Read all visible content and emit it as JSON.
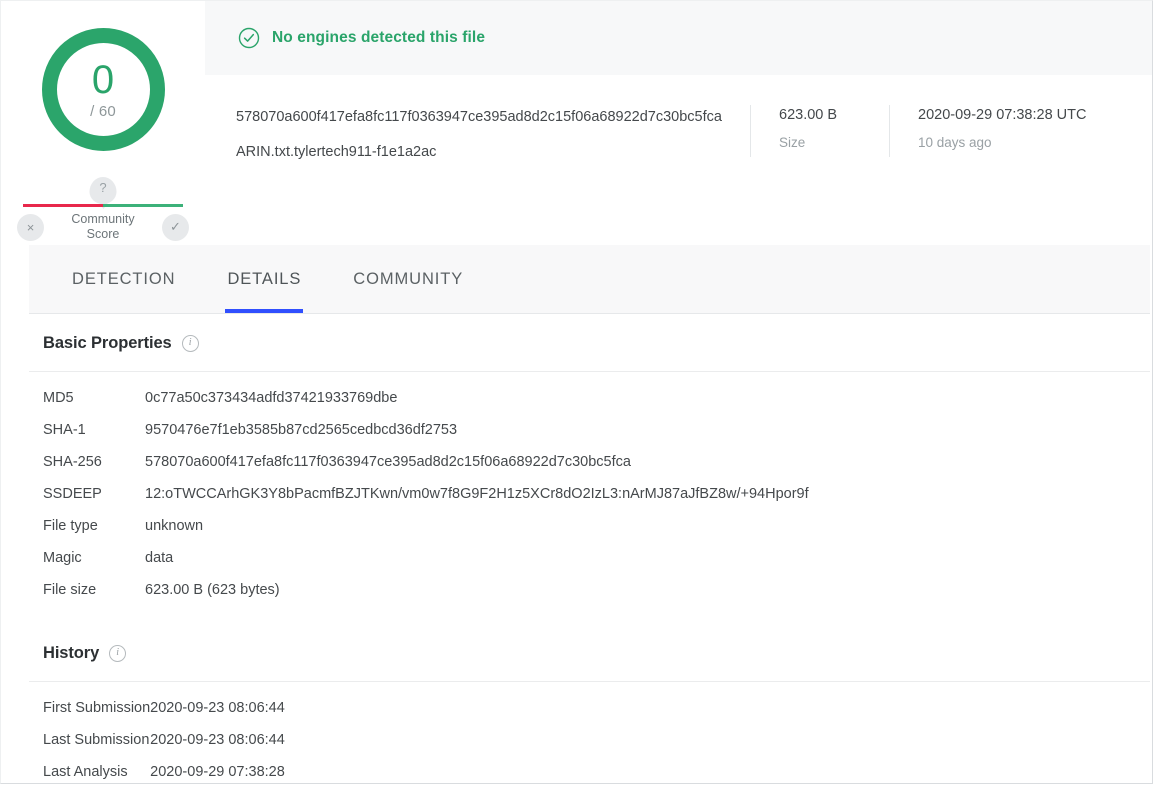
{
  "detection": {
    "score": "0",
    "total": "/ 60",
    "banner_text": "No engines detected this file",
    "banner_icon": "check-circle-icon",
    "accent_green": "#2aa46a",
    "donut_green": "#2ba56b"
  },
  "community_score": {
    "label_line1": "Community",
    "label_line2": "Score",
    "pin_glyph": "?",
    "negative_icon": "×",
    "positive_icon": "✓",
    "negative_color": "#e8274b",
    "positive_color": "#3cb179"
  },
  "file": {
    "sha256_display": "578070a600f417efa8fc117f0363947ce395ad8d2c15f06a68922d7c30bc5fca",
    "name": "ARIN.txt.tylertech911-f1e1a2ac",
    "size_value": "623.00 B",
    "size_label": "Size",
    "scan_date": "2020-09-29 07:38:28 UTC",
    "scan_relative": "10 days ago"
  },
  "tabs": [
    {
      "label": "DETECTION",
      "active": false
    },
    {
      "label": "DETAILS",
      "active": true
    },
    {
      "label": "COMMUNITY",
      "active": false
    }
  ],
  "tab_accent": "#304ffe",
  "basic_properties": {
    "title": "Basic Properties",
    "info_icon": "info-icon",
    "rows": [
      {
        "key": "MD5",
        "value": "0c77a50c373434adfd37421933769dbe"
      },
      {
        "key": "SHA-1",
        "value": "9570476e7f1eb3585b87cd2565cedbcd36df2753"
      },
      {
        "key": "SHA-256",
        "value": "578070a600f417efa8fc117f0363947ce395ad8d2c15f06a68922d7c30bc5fca"
      },
      {
        "key": "SSDEEP",
        "value": "12:oTWCCArhGK3Y8bPacmfBZJTKwn/vm0w7f8G9F2H1z5XCr8dO2IzL3:nArMJ87aJfBZ8w/+94Hpor9f"
      },
      {
        "key": "File type",
        "value": "unknown"
      },
      {
        "key": "Magic",
        "value": "data"
      },
      {
        "key": "File size",
        "value": "623.00 B (623 bytes)"
      }
    ]
  },
  "history": {
    "title": "History",
    "info_icon": "info-icon",
    "rows": [
      {
        "key": "First Submission",
        "value": "2020-09-23 08:06:44"
      },
      {
        "key": "Last Submission",
        "value": "2020-09-23 08:06:44"
      },
      {
        "key": "Last Analysis",
        "value": "2020-09-29 07:38:28"
      }
    ]
  }
}
